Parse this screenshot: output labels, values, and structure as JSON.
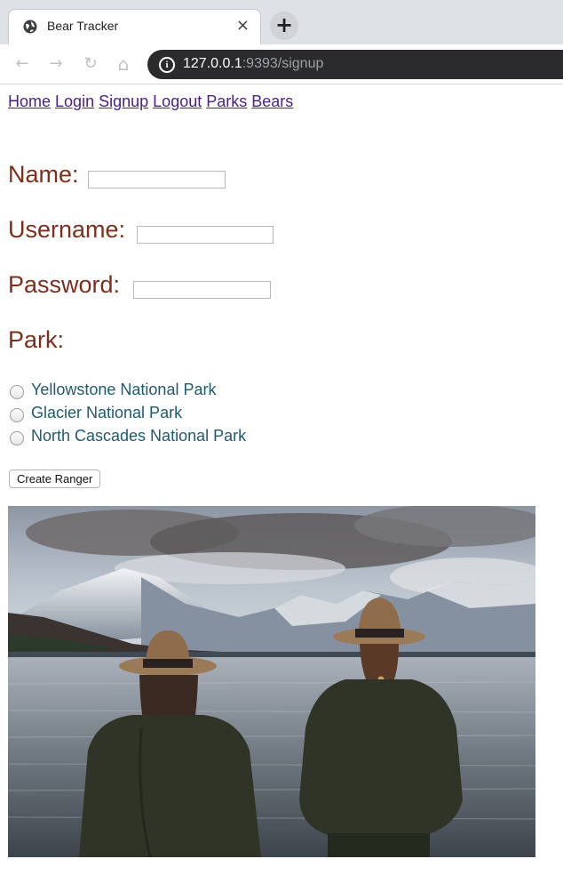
{
  "browser": {
    "tab_title": "Bear Tracker",
    "tab_close": "×",
    "new_tab": "+",
    "url_host": "127.0.0.1",
    "url_rest": ":9393/signup",
    "back": "←",
    "forward": "→",
    "reload": "↻",
    "home": "⌂",
    "info": "i"
  },
  "nav": {
    "links": [
      "Home",
      "Login",
      "Signup",
      "Logout",
      "Parks",
      "Bears"
    ]
  },
  "form": {
    "name_label": "Name:",
    "username_label": "Username:",
    "password_label": "Password:",
    "park_label": "Park:",
    "name_value": "",
    "username_value": "",
    "password_value": "",
    "parks": [
      "Yellowstone National Park",
      "Glacier National Park",
      "North Cascades National Park"
    ],
    "submit_label": "Create Ranger"
  },
  "colors": {
    "label": "#7e2e1b",
    "park_option": "#1e5a6e",
    "link": "#4b1e8a"
  }
}
